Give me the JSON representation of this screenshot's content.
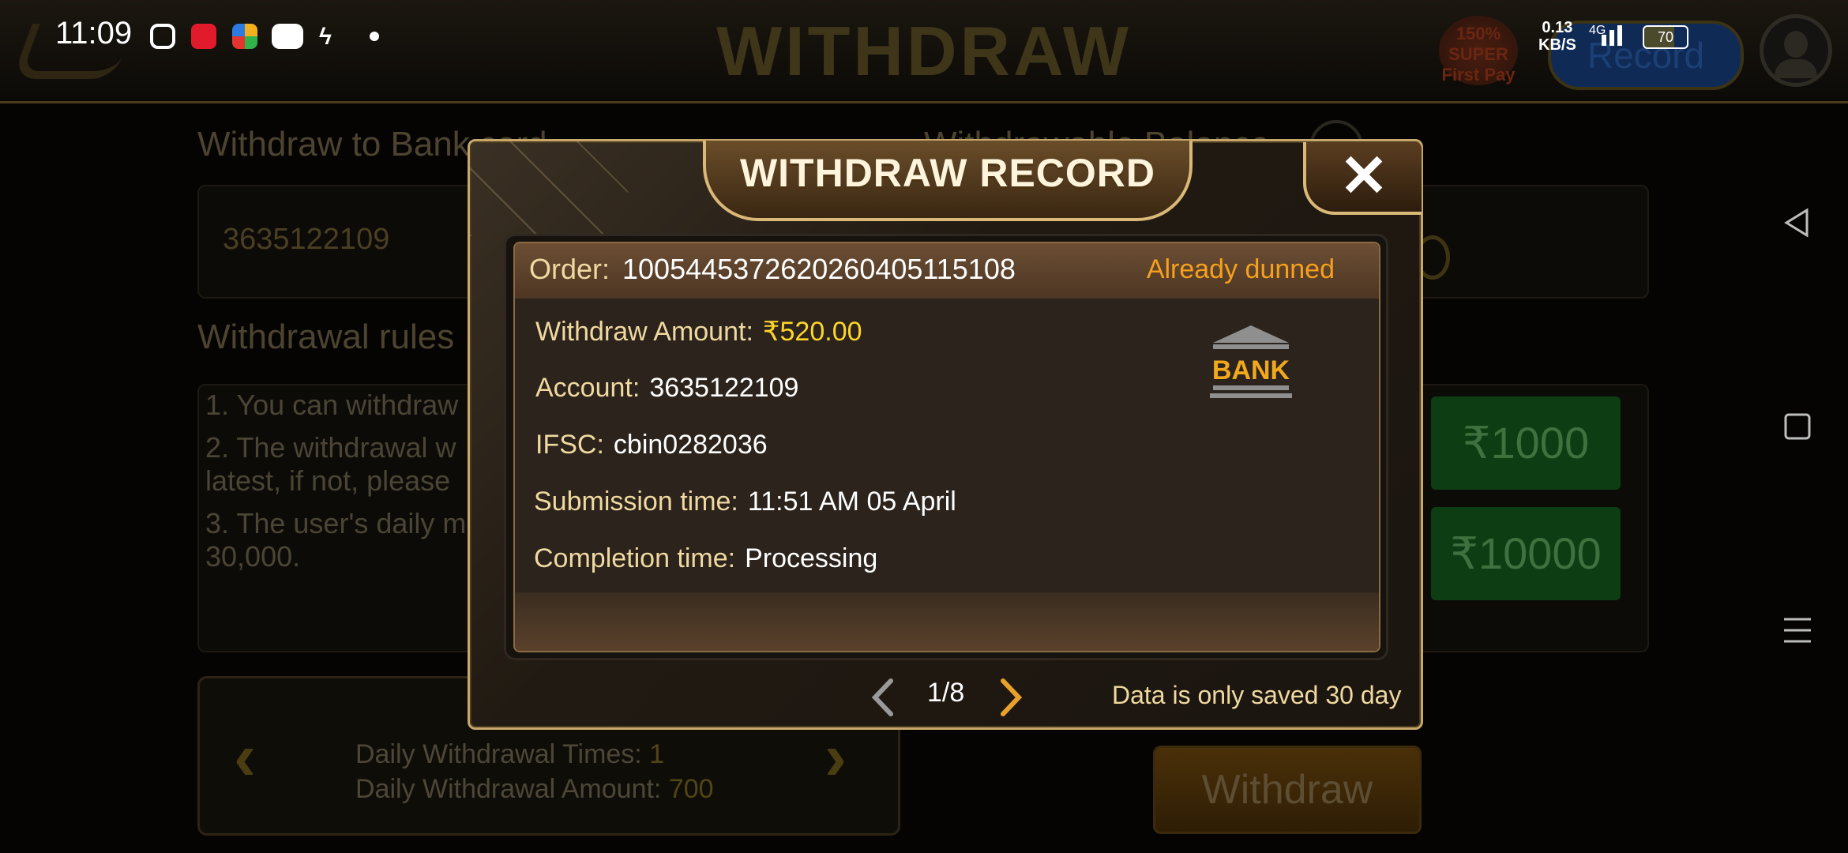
{
  "status_bar": {
    "time": "11:09",
    "net_speed_value": "0.13",
    "net_speed_unit": "KB/S",
    "network": "4G",
    "battery": "70"
  },
  "background": {
    "title": "WITHDRAW",
    "record_label": "Record",
    "first_pay_badge": "150% SUPER First Pay",
    "bank_card_label": "Withdraw to Bank card",
    "withdrawable_label": "Withdrawable Balance",
    "account_value": "3635122109",
    "rules_label": "Withdrawal rules",
    "rules": [
      "1. You can withdraw",
      "2. The withdrawal w latest, if not, please",
      "3. The user's daily m 30,000."
    ],
    "amounts": [
      "₹1000",
      "₹10000"
    ],
    "daily_times_label": "Daily Withdrawal Times:",
    "daily_times_value": "1",
    "daily_amount_label": "Daily Withdrawal Amount:",
    "daily_amount_value": "700",
    "withdraw_button": "Withdraw"
  },
  "modal": {
    "title": "WITHDRAW RECORD",
    "close_icon": "close-icon",
    "record": {
      "order_label": "Order:",
      "order_value": "1005445372620260405115108",
      "status": "Already dunned",
      "status_color": "#f6a01c",
      "amount_label": "Withdraw Amount:",
      "amount_value": "₹520.00",
      "account_label": "Account:",
      "account_value": "3635122109",
      "ifsc_label": "IFSC:",
      "ifsc_value": "cbin0282036",
      "submission_label": "Submission time:",
      "submission_value": "11:51 AM 05 April",
      "completion_label": "Completion time:",
      "completion_value": "Processing",
      "bank_icon_text": "BANK"
    },
    "pagination": {
      "current": "1/8",
      "prev_icon": "chevron-left-icon",
      "next_icon": "chevron-right-icon"
    },
    "note": "Data is only saved 30 day"
  }
}
